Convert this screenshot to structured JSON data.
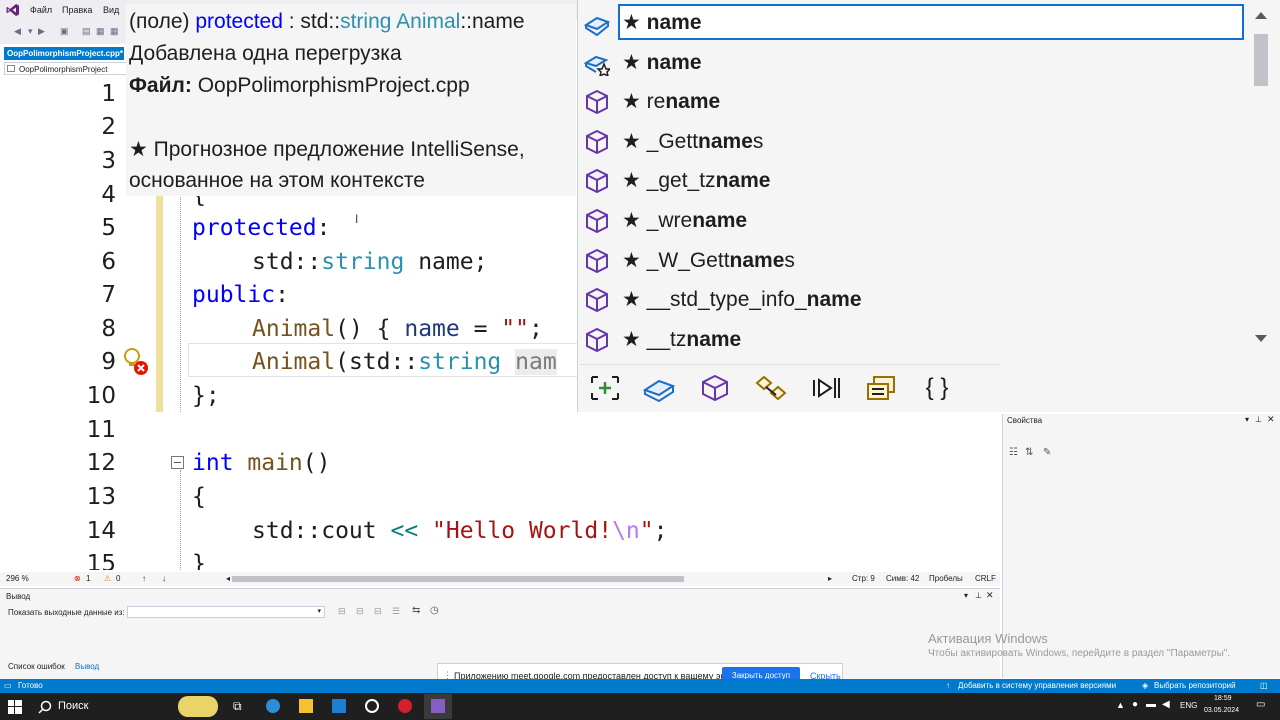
{
  "menu": {
    "items": [
      "Файл",
      "Правка",
      "Вид"
    ]
  },
  "doc_tab": {
    "label": "OopPolimorphismProject.cpp*",
    "nav_label": "OopPolimorphismProject"
  },
  "tooltip": {
    "signature_prefix": "(поле) ",
    "signature_kw": "protected",
    "signature_rest1": " : std::",
    "signature_type": "string",
    "signature_class": " Animal",
    "signature_rest2": "::name",
    "overload_note": "Добавлена одна перегрузка",
    "file_label": "Файл:",
    "file_name": " OopPolimorphismProject.cpp",
    "predicted_line1": "★ Прогнозное предложение IntelliSense,",
    "predicted_line2": "основанное на этом контексте"
  },
  "editor": {
    "line_numbers": [
      "1",
      "2",
      "3",
      "4",
      "5",
      "6",
      "7",
      "8",
      "9",
      "10",
      "11",
      "12",
      "13",
      "14",
      "15"
    ],
    "code": {
      "l4": "{",
      "l5_kw": "protected",
      "l5_rest": ":",
      "l6_ns": "std::",
      "l6_type": "string",
      "l6_rest": " name;",
      "l7_kw": "public",
      "l7_rest": ":",
      "l8_fn": "Animal",
      "l8_rest1": "() { ",
      "l8_id": "name",
      "l8_rest2": " = ",
      "l8_str": "\"\"",
      "l8_rest3": ";",
      "l9_fn": "Animal",
      "l9_rest1": "(std::",
      "l9_type": "string",
      "l9_rest2": " ",
      "l9_partial": "nam",
      "l10": "};",
      "l12_kw": "int",
      "l12_fn": " main",
      "l12_rest": "()",
      "l13": "{",
      "l14_ns": "std::cout ",
      "l14_op": "<<",
      "l14_str1": " \"Hello World!",
      "l14_esc": "\\n",
      "l14_str2": "\"",
      "l14_rest": ";",
      "l15": "}"
    }
  },
  "completion": {
    "items": [
      {
        "prefix": "★ ",
        "pre": "",
        "bold": "name",
        "post": "",
        "icon": "field-icon",
        "selected": true
      },
      {
        "prefix": "★ ",
        "pre": "",
        "bold": "name",
        "post": "",
        "icon": "field-star-icon",
        "selected": false
      },
      {
        "prefix": "★ ",
        "pre": "re",
        "bold": "name",
        "post": "",
        "icon": "method-icon",
        "selected": false
      },
      {
        "prefix": "★ ",
        "pre": "_Gett",
        "bold": "name",
        "post": "s",
        "icon": "method-icon",
        "selected": false
      },
      {
        "prefix": "★ ",
        "pre": "_get_tz",
        "bold": "name",
        "post": "",
        "icon": "method-icon",
        "selected": false
      },
      {
        "prefix": "★ ",
        "pre": "_wre",
        "bold": "name",
        "post": "",
        "icon": "method-icon",
        "selected": false
      },
      {
        "prefix": "★ ",
        "pre": "_W_Gett",
        "bold": "name",
        "post": "s",
        "icon": "method-icon",
        "selected": false
      },
      {
        "prefix": "★ ",
        "pre": "__std_type_info_",
        "bold": "name",
        "post": "",
        "icon": "method-icon",
        "selected": false
      },
      {
        "prefix": "★ ",
        "pre": "__tz",
        "bold": "name",
        "post": "",
        "icon": "method-icon",
        "selected": false
      }
    ],
    "filters": [
      "expand-scope-icon",
      "field-filter-icon",
      "method-filter-icon",
      "namespace-filter-icon",
      "keyword-filter-icon",
      "snippet-filter-icon",
      "braces-filter-icon"
    ],
    "braces_label": "{ }"
  },
  "editor_status": {
    "zoom": "296 %",
    "errors": "1",
    "warnings": "0",
    "line": "Стр: 9",
    "col": "Симв: 42",
    "spaces": "Пробелы",
    "eol": "CRLF"
  },
  "properties": {
    "title": "Свойства"
  },
  "output": {
    "title": "Вывод",
    "show_label": "Показать выходные данные из:",
    "tabs": [
      "Список ошибок",
      "Вывод"
    ]
  },
  "watermark": {
    "title": "Активация Windows",
    "subtitle": "Чтобы активировать Windows, перейдите в раздел \"Параметры\"."
  },
  "share_banner": {
    "text": "Приложению meet.google.com предоставлен доступ к вашему экрану.",
    "stop_label": "Закрыть доступ",
    "hide_label": "Скрыть"
  },
  "vs_status": {
    "ready": "Готово",
    "vcs": "Добавить в систему управления версиями",
    "repo": "Выбрать репозиторий"
  },
  "taskbar": {
    "search": "Поиск",
    "lang": "ENG",
    "time": "18:59",
    "date": "03.05.2024"
  },
  "colors": {
    "accent": "#007acc",
    "keyword": "#0000ff",
    "type": "#2b91af",
    "string": "#a31515",
    "function": "#74531f",
    "icon_purple": "#6936aa",
    "icon_blue": "#1c6fc7"
  }
}
